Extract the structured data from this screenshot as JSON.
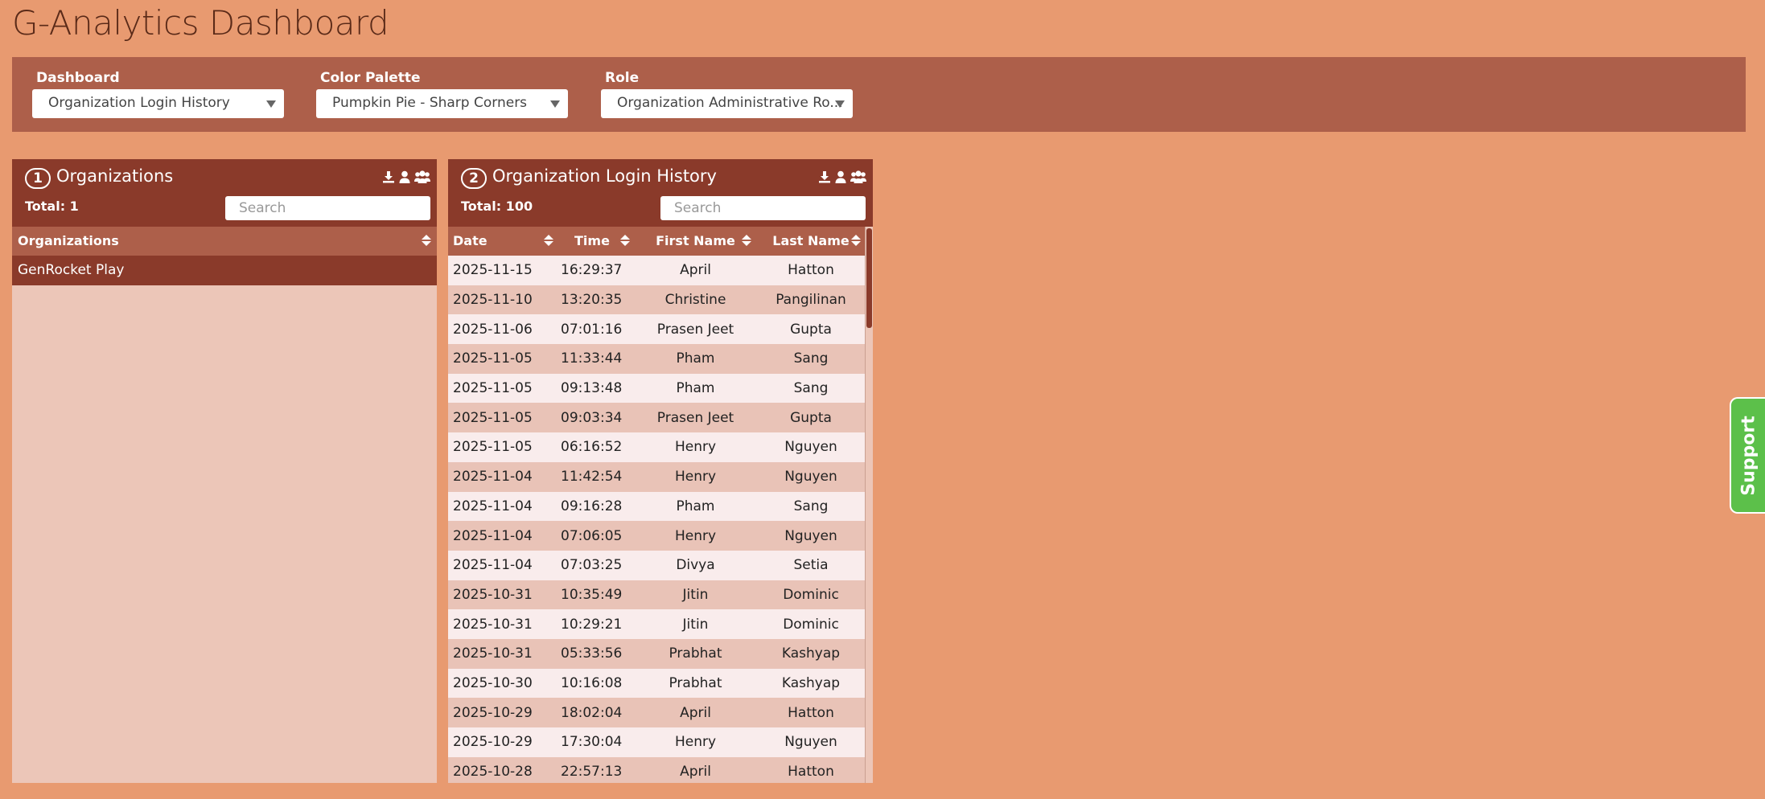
{
  "app": {
    "title": "G-Analytics Dashboard"
  },
  "filters": {
    "dashboard": {
      "label": "Dashboard",
      "value": "Organization Login History"
    },
    "palette": {
      "label": "Color Palette",
      "value": "Pumpkin Pie - Sharp Corners"
    },
    "role": {
      "label": "Role",
      "value": "Organization Administrative Ro..."
    }
  },
  "panel1": {
    "number": "1",
    "title": "Organizations",
    "total": "Total: 1",
    "search_placeholder": "Search",
    "column": "Organizations",
    "rows": [
      "GenRocket Play"
    ]
  },
  "panel2": {
    "number": "2",
    "title": "Organization Login History",
    "total": "Total: 100",
    "search_placeholder": "Search",
    "columns": [
      "Date",
      "Time",
      "First Name",
      "Last Name"
    ],
    "rows": [
      [
        "2025-11-15",
        "16:29:37",
        "April",
        "Hatton"
      ],
      [
        "2025-11-10",
        "13:20:35",
        "Christine",
        "Pangilinan"
      ],
      [
        "2025-11-06",
        "07:01:16",
        "Prasen Jeet",
        "Gupta"
      ],
      [
        "2025-11-05",
        "11:33:44",
        "Pham",
        "Sang"
      ],
      [
        "2025-11-05",
        "09:13:48",
        "Pham",
        "Sang"
      ],
      [
        "2025-11-05",
        "09:03:34",
        "Prasen Jeet",
        "Gupta"
      ],
      [
        "2025-11-05",
        "06:16:52",
        "Henry",
        "Nguyen"
      ],
      [
        "2025-11-04",
        "11:42:54",
        "Henry",
        "Nguyen"
      ],
      [
        "2025-11-04",
        "09:16:28",
        "Pham",
        "Sang"
      ],
      [
        "2025-11-04",
        "07:06:05",
        "Henry",
        "Nguyen"
      ],
      [
        "2025-11-04",
        "07:03:25",
        "Divya",
        "Setia"
      ],
      [
        "2025-10-31",
        "10:35:49",
        "Jitin",
        "Dominic"
      ],
      [
        "2025-10-31",
        "10:29:21",
        "Jitin",
        "Dominic"
      ],
      [
        "2025-10-31",
        "05:33:56",
        "Prabhat",
        "Kashyap"
      ],
      [
        "2025-10-30",
        "10:16:08",
        "Prabhat",
        "Kashyap"
      ],
      [
        "2025-10-29",
        "18:02:04",
        "April",
        "Hatton"
      ],
      [
        "2025-10-29",
        "17:30:04",
        "Henry",
        "Nguyen"
      ],
      [
        "2025-10-28",
        "22:57:13",
        "April",
        "Hatton"
      ]
    ]
  },
  "support": {
    "label": "Support"
  },
  "icons": {
    "download": "download-icon",
    "user": "user-icon",
    "users": "users-icon"
  },
  "colors": {
    "background": "#e89a70",
    "filter_bar": "#ad5f4a",
    "panel_header": "#8a3a2a",
    "row_odd": "#f9ecec",
    "row_even": "#e9c3b7",
    "support": "#5cc04a"
  }
}
